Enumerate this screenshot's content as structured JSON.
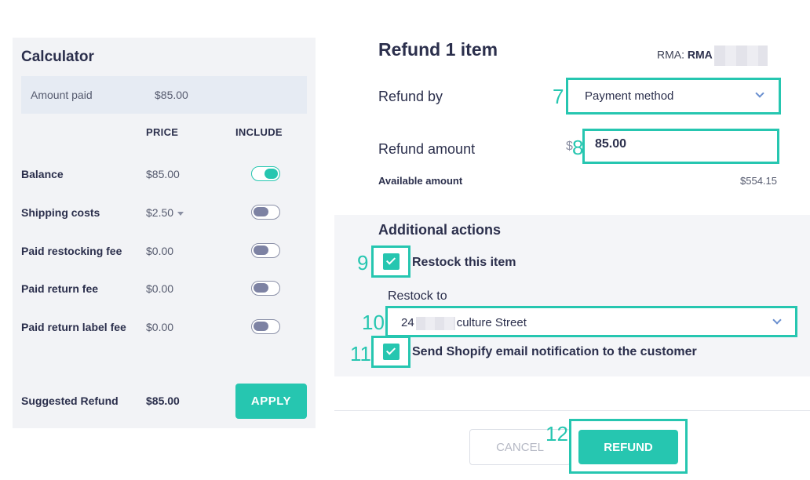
{
  "calculator": {
    "title": "Calculator",
    "amount_paid": {
      "label": "Amount paid",
      "value": "$85.00"
    },
    "columns": {
      "price": "PRICE",
      "include": "INCLUDE"
    },
    "rows": [
      {
        "label": "Balance",
        "price": "$85.00",
        "included": true
      },
      {
        "label": "Shipping costs",
        "price": "$2.50",
        "included": false,
        "has_dropdown": true
      },
      {
        "label": "Paid restocking fee",
        "price": "$0.00",
        "included": false
      },
      {
        "label": "Paid return fee",
        "price": "$0.00",
        "included": false
      },
      {
        "label": "Paid return label fee",
        "price": "$0.00",
        "included": false
      }
    ],
    "suggested_refund": {
      "label": "Suggested Refund",
      "value": "$85.00"
    },
    "apply_label": "APPLY"
  },
  "refund": {
    "title": "Refund 1 item",
    "rma_label": "RMA:",
    "rma_value": "RMA",
    "refund_by": {
      "label": "Refund by",
      "selected": "Payment method"
    },
    "refund_amount": {
      "label": "Refund amount",
      "currency": "$",
      "value": "85.00"
    },
    "available": {
      "label": "Available amount",
      "value": "$554.15"
    }
  },
  "additional_actions": {
    "title": "Additional actions",
    "restock_item": {
      "label": "Restock this item",
      "checked": true
    },
    "restock_to": {
      "label": "Restock to",
      "prefix": "24",
      "suffix": "culture Street"
    },
    "send_notification": {
      "label": "Send Shopify email notification to the customer",
      "checked": true
    }
  },
  "footer": {
    "cancel_label": "CANCEL",
    "refund_label": "REFUND"
  },
  "annotations": {
    "n7": "7",
    "n8": "8",
    "n9": "9",
    "n10": "10",
    "n11": "11",
    "n12": "12"
  },
  "colors": {
    "accent": "#26c6b0",
    "text": "#2b2f4c",
    "panel": "#f2f3f6"
  }
}
